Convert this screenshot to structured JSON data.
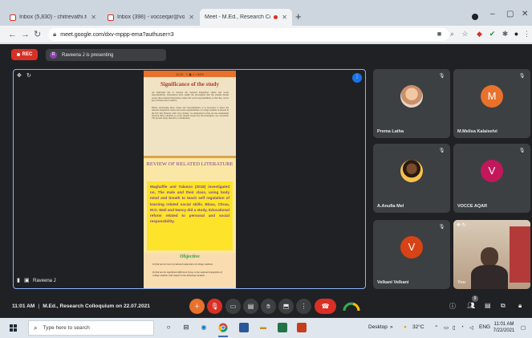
{
  "browser": {
    "tabs": [
      {
        "title": "Inbox (5,830) - chitrevathi.tuty@...",
        "active": false,
        "icon": "gmail-icon"
      },
      {
        "title": "Inbox (398) - vocceqar@vocceq...",
        "active": false,
        "icon": "gmail-icon"
      },
      {
        "title": "Meet - M.Ed., Research Collo...",
        "active": true,
        "icon": "meet-icon"
      }
    ],
    "new_tab": "+",
    "address": "meet.google.com/dxv-mppp-ema?authuser=3"
  },
  "meet": {
    "rec_label": "REC",
    "presenter_initial": "R",
    "presenting_text": "Raveena J is presenting",
    "stage_name": "Raveena J",
    "time": "11:01 AM",
    "meeting_title": "M.Ed., Research Colloquium on 22.07.2021",
    "participant_badge": "9",
    "participants": [
      {
        "name": "Prema Latha",
        "initial": "",
        "color": "#3c4043"
      },
      {
        "name": "M.Melisa Kalaiselvi",
        "initial": "M",
        "color": "#e8712b"
      },
      {
        "name": "A.Anufia Mel",
        "initial": "",
        "color": "#3c4043"
      },
      {
        "name": "VOCCE AQAR",
        "initial": "V",
        "color": "#c2185b"
      },
      {
        "name": "Velkani Velkani",
        "initial": "V",
        "color": "#d84315"
      },
      {
        "name": "You",
        "initial": "",
        "color": "#3c4043"
      }
    ]
  },
  "slide": {
    "status_time": "11:01",
    "status_extra": "≡ ▣ ◐ • 94%",
    "heading1": "Significance of the study",
    "para1": "An individual has to develop the national integration values and social responsibilities. Experiences have taught the investigator that the student should posses these national integration values and social responsibilities so that they can be good citizens and to behave.",
    "para2": "Before developing these values and responsibilities, it is necessary to know the national integration values and social responsibilities of college students at present in the ISS Tuty Branch, with a few studies, we understand to find out the relationship between these variables so as the student reciprocity the investigator are concerned. The present study, therefore, is undertaken.",
    "heading2": "REVIEW OF RELATED LITERATURE",
    "review": "Maghaffie and Yalanoo (2018) investigated on, The male and their class, using body mind and breath to teach self regulation of learning related social skills. Blasa, Chrua, M.O. Wail and Nancy did a study, Educational reform related to personal and social responsibility.",
    "heading3": "Objective",
    "obj1": "To find out the level of national integration of college students.",
    "obj2": "To find out the significant difference if any, in the national integration of college students with respect to the following variable."
  },
  "taskbar": {
    "search_placeholder": "Type here to search",
    "desktop_label": "Desktop",
    "temperature": "32°C",
    "language": "ENG",
    "clock_time": "11:01 AM",
    "clock_date": "7/22/2021"
  },
  "colors": {
    "meet_bg": "#202124",
    "accent_blue": "#8ab4f8",
    "hangup_red": "#d93025",
    "slide_yellow": "#fde42a"
  }
}
